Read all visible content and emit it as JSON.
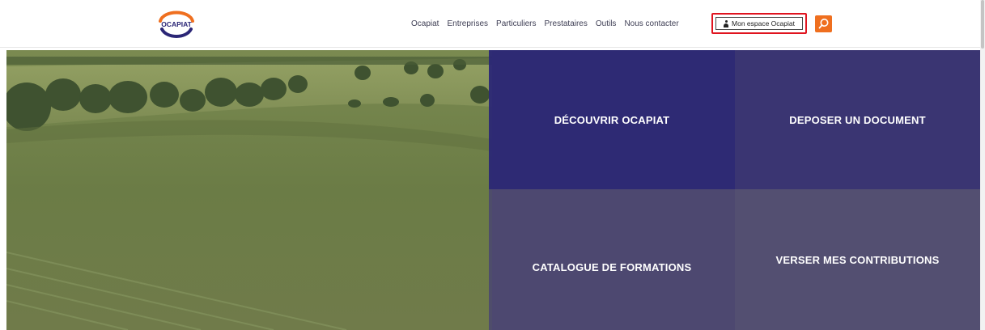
{
  "brand": {
    "logo_text": "OCAPIAT",
    "colors": {
      "orange": "#ef6f1f",
      "navy": "#2b2676",
      "highlight": "#e0141f"
    }
  },
  "nav": {
    "items": [
      {
        "label": "Ocapiat"
      },
      {
        "label": "Entreprises"
      },
      {
        "label": "Particuliers"
      },
      {
        "label": "Prestataires"
      },
      {
        "label": "Outils"
      },
      {
        "label": "Nous contacter"
      }
    ],
    "account_label": "Mon espace Ocapiat",
    "account_icon": "user-icon",
    "search_icon": "search-icon"
  },
  "hero": {
    "tiles": [
      {
        "label": "DÉCOUVRIR OCAPIAT"
      },
      {
        "label": "DEPOSER UN DOCUMENT"
      },
      {
        "label": "CATALOGUE DE FORMATIONS"
      },
      {
        "label": "VERSER MES CONTRIBUTIONS"
      }
    ]
  }
}
